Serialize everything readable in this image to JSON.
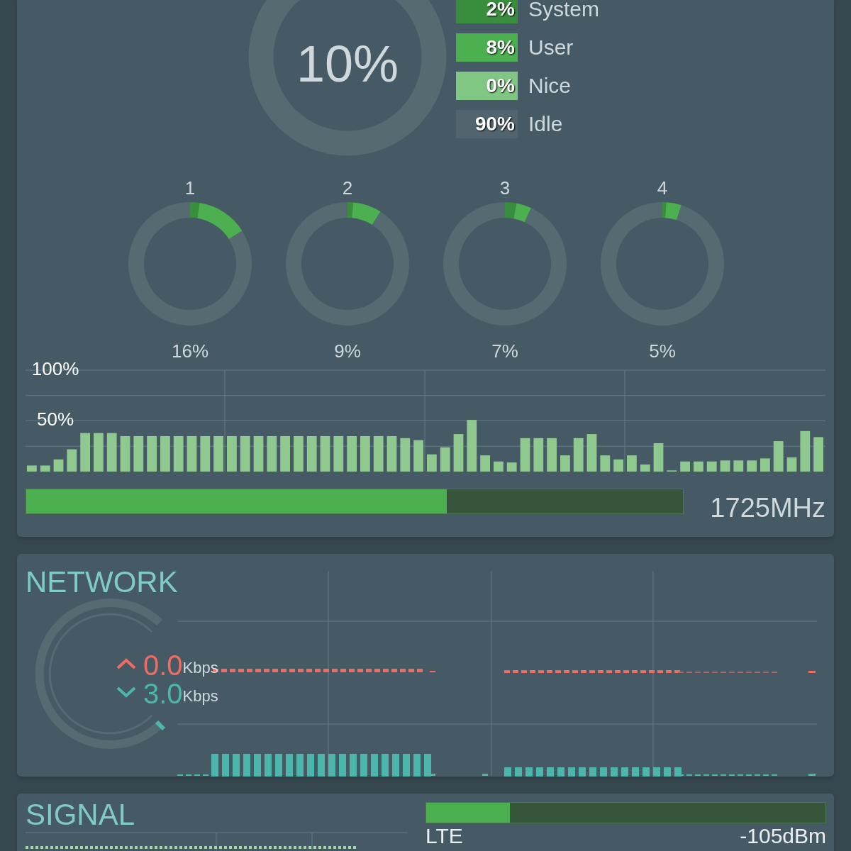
{
  "cpu": {
    "total": {
      "label": "10%"
    },
    "legend": [
      {
        "value": "2%",
        "label": "System",
        "color": "#388e3c"
      },
      {
        "value": "8%",
        "label": "User",
        "color": "#4caf50"
      },
      {
        "value": "0%",
        "label": "Nice",
        "color": "#81c784"
      },
      {
        "value": "90%",
        "label": "Idle",
        "color": "#52646e"
      }
    ],
    "cores": [
      {
        "label": "1",
        "reading": "16%",
        "chart_data": {
          "type": "donut",
          "values": [
            2.5,
            13.5,
            84
          ]
        }
      },
      {
        "label": "2",
        "reading": "9%",
        "chart_data": {
          "type": "donut",
          "values": [
            1.5,
            7.5,
            91
          ]
        }
      },
      {
        "label": "3",
        "reading": "7%",
        "chart_data": {
          "type": "donut",
          "values": [
            3,
            4,
            93
          ]
        }
      },
      {
        "label": "4",
        "reading": "5%",
        "chart_data": {
          "type": "donut",
          "values": [
            1,
            4,
            95
          ]
        }
      }
    ],
    "history": {
      "chart_data": {
        "type": "bar",
        "ylim": [
          0,
          100
        ],
        "yticks": [
          {
            "value": 50,
            "label": "50%"
          },
          {
            "value": 100,
            "label": "100%"
          }
        ],
        "values": [
          6,
          6,
          12,
          22,
          38,
          38,
          38,
          35,
          35,
          35,
          35,
          35,
          35,
          35,
          35,
          35,
          35,
          35,
          35,
          35,
          35,
          35,
          35,
          35,
          35,
          35,
          35,
          35,
          33,
          31,
          17,
          24,
          37,
          51,
          16,
          10,
          9,
          33,
          33,
          33,
          16,
          33,
          37,
          16,
          12,
          16,
          7,
          28,
          1,
          10,
          10,
          10,
          11,
          11,
          11,
          13,
          30,
          14,
          40,
          34
        ]
      }
    },
    "frequency": {
      "level": 0.64,
      "reading": "1725MHz"
    }
  },
  "network": {
    "title": "NETWORK",
    "upload": {
      "value": "0.0",
      "unit": "Kbps"
    },
    "download": {
      "value": "3.0",
      "unit": "Kbps"
    }
  },
  "signal": {
    "title": "SIGNAL",
    "level": 0.21,
    "type": "LTE",
    "reading": "-105dBm"
  }
}
